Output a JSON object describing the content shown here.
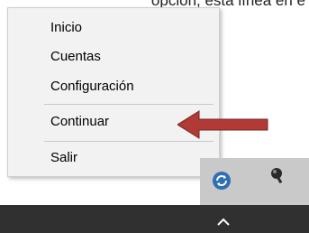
{
  "caption": "opción, esta línea en e",
  "menu": {
    "items": [
      "Inicio",
      "Cuentas",
      "Configuración",
      "Continuar",
      "Salir"
    ]
  },
  "colors": {
    "menu_bg": "#f2f2f2",
    "taskbar": "#303030",
    "arrow": "#b03a35",
    "tray_icon": "#2f6fb3"
  },
  "icons": {
    "tray_sync": "sync-icon",
    "tray_network": "network-icon",
    "show_hidden": "chevron-up-icon",
    "pointer": "left-arrow-icon"
  }
}
